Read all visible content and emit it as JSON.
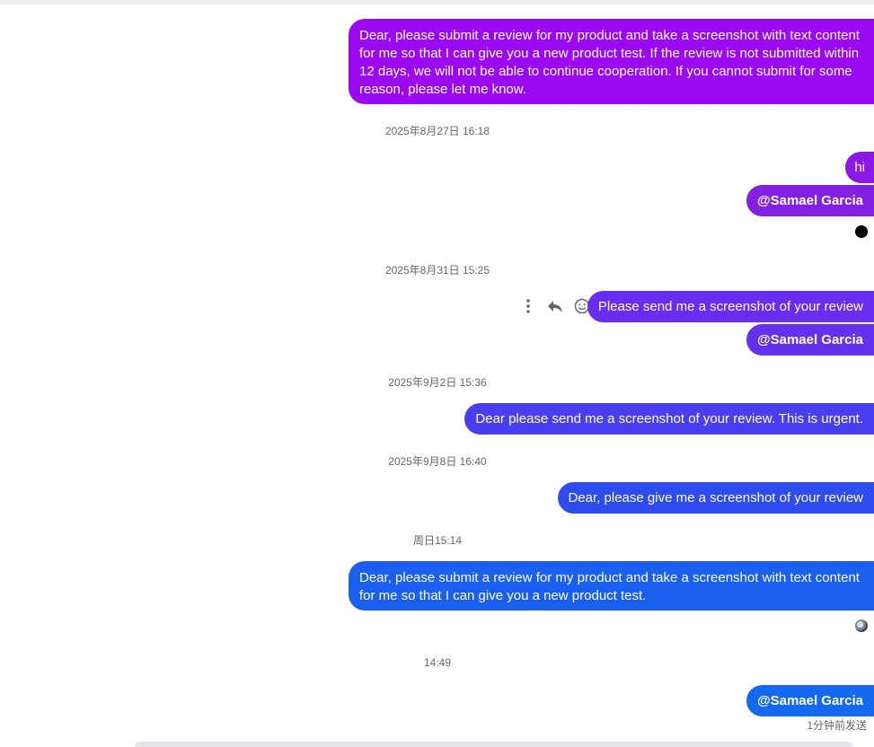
{
  "messages": [
    {
      "text": "Dear, please submit a review for my product and take a screenshot with text content for me so that I can give you a new product test. If the review is not submitted within 12 days, we will not be able to continue cooperation. If you cannot submit for some reason, please let me know.",
      "color": "#9a09f2"
    },
    {
      "text": "hi",
      "color": "#8a18e6"
    },
    {
      "text": "@Samael Garcia",
      "color": "#8420e3"
    },
    {
      "text": "Please send me a screenshot of your review",
      "color": "#6a2cee"
    },
    {
      "text": "@Samael Garcia",
      "color": "#6431ee"
    },
    {
      "text": "Dear please send me a screenshot of your review. This is urgent.",
      "color": "#4a3ff0"
    },
    {
      "text": "Dear, please give me a screenshot of your review",
      "color": "#2e4df1"
    },
    {
      "text": "Dear, please submit a review for my product and take a screenshot with text content for me so that I can give you a new product test.",
      "color": "#1b5ff0"
    },
    {
      "text": "@Samael Garcia",
      "color": "#1569f0"
    }
  ],
  "timestamps": [
    "2025年8月27日 16:18",
    "2025年8月31日 15:25",
    "2025年9月2日 15:36",
    "2025年9月8日 16:40",
    "周日15:14",
    "14:49"
  ],
  "status": {
    "sent": "1分钟前发送"
  },
  "icons": {
    "more": "more-vertical-icon",
    "reply": "reply-icon",
    "react": "smiley-icon"
  }
}
